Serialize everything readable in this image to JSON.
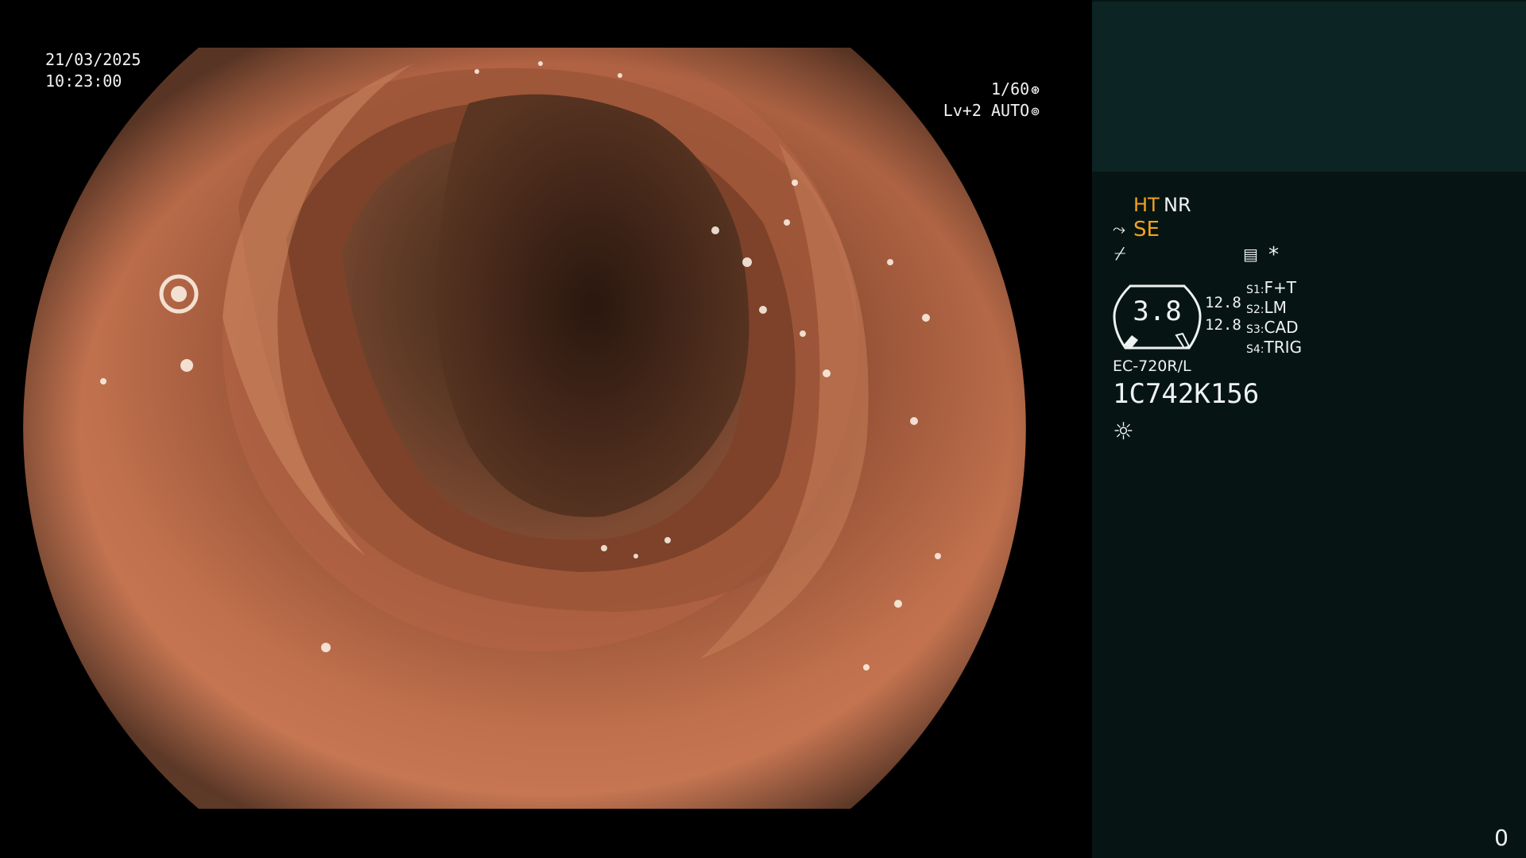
{
  "osd": {
    "date": "21/03/2025",
    "time": "10:23:00",
    "shutter": "1/60",
    "level": "Lv+2 AUTO",
    "shutter_icon": "aperture-icon",
    "auto_icon": "iris-icon"
  },
  "panel": {
    "ht": "HT",
    "nr": "NR",
    "se": "SE",
    "gauge_value": "3.8",
    "readout_1": "12.8",
    "readout_2": "12.8",
    "switches": [
      {
        "key": "S1:",
        "value": "F+T"
      },
      {
        "key": "S2:",
        "value": "LM"
      },
      {
        "key": "S3:",
        "value": "CAD"
      },
      {
        "key": "S4:",
        "value": "TRIG"
      }
    ],
    "model": "EC-720R/L",
    "serial": "1C742K156",
    "counter": "0",
    "icons": [
      "scope-icon",
      "freeze-icon",
      "memo-icon",
      "star-icon",
      "light-icon"
    ]
  },
  "colors": {
    "panel_background": "#061513",
    "panel_top": "#0c2424",
    "accent_orange": "#f3a21d"
  }
}
